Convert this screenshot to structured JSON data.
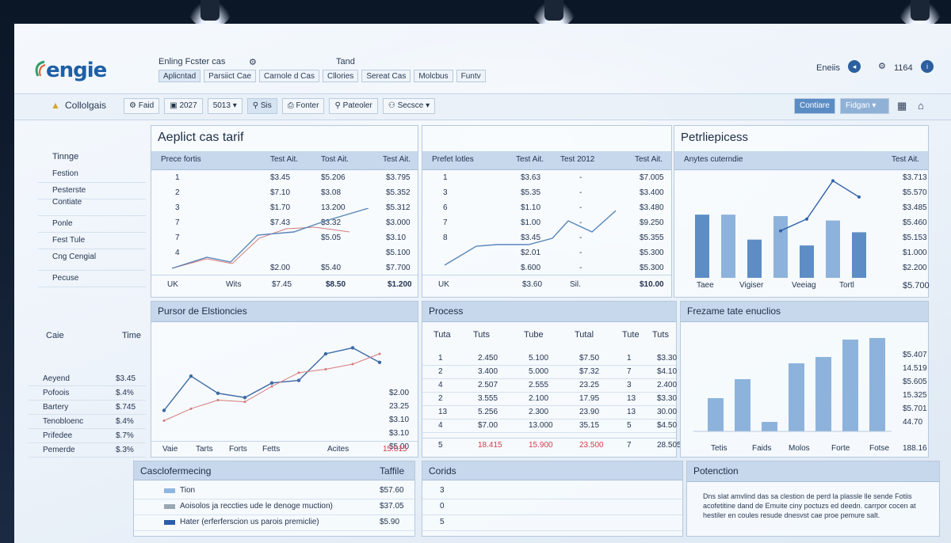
{
  "brand": {
    "logo": "engie"
  },
  "topnav": {
    "title": "Enling Fcster cas",
    "extra": "Tand",
    "tabs": [
      "Aplicntad",
      "Parsiict Cae",
      "Carnole d Cas",
      "Cllories",
      "Sereat Cas",
      "Molcbus",
      "Funtv"
    ]
  },
  "user": {
    "name": "Eneiis",
    "count": "1164"
  },
  "toolbar": {
    "section": "Collolgais",
    "items": [
      "Faid",
      "2027",
      "5013",
      "Sis",
      "Fonter",
      "Pateoler",
      "Secsce"
    ],
    "right_buttons": [
      "Contiare",
      "Fidgan"
    ]
  },
  "sidebar": {
    "heading": "Tinnge",
    "items": [
      "Festion",
      "Pesterste",
      "Contiate",
      "Ponle",
      "Fest Tule",
      "Cng Cengial",
      "Pecuse"
    ]
  },
  "tarif": {
    "title": "Aeplict cas tarif",
    "headers": [
      "Prece fortis",
      "Test Ait.",
      "Tost Ait.",
      "Test Ait."
    ],
    "rows": [
      [
        "1",
        "$3.45",
        "$5.206",
        "$3.795"
      ],
      [
        "2",
        "$7.10",
        "$3.08",
        "$5.352"
      ],
      [
        "3",
        "$1.70",
        "13.200",
        "$5.312"
      ],
      [
        "7",
        "$7.43",
        "$3.32",
        "$3.000"
      ],
      [
        "7",
        "",
        "$5.05",
        "$3.10"
      ],
      [
        "4",
        "",
        "",
        "$5.100"
      ],
      [
        "",
        "$2.00",
        "$5.40",
        "$7.700"
      ]
    ],
    "footer": [
      "UK",
      "Wits",
      "$7.45",
      "$8.50",
      "$1.200"
    ]
  },
  "prefer": {
    "headers": [
      "Prefet lotles",
      "Test Ait.",
      "Test 2012",
      "Test Ait."
    ],
    "rows": [
      [
        "1",
        "$3.63",
        "",
        "$7.005"
      ],
      [
        "3",
        "$5.35",
        "",
        "$3.400"
      ],
      [
        "6",
        "$1.10",
        "",
        "$3.480"
      ],
      [
        "7",
        "$1.00",
        "",
        "$9.250"
      ],
      [
        "8",
        "$3.45",
        "",
        "$5.355"
      ],
      [
        "",
        "$2.01",
        "",
        "$5.300"
      ],
      [
        "",
        "$.600",
        "",
        "$5.300"
      ]
    ],
    "footer": [
      "UK",
      "$3.60",
      "Sil.",
      "$10.00"
    ]
  },
  "petrl": {
    "title": "Petrliepicess",
    "header_left": "Anytes cuterndie",
    "header_right": "Test Ait.",
    "values": [
      "$3.713",
      "$5.570",
      "$3.485",
      "$5.460",
      "$5.153",
      "$1.000",
      "$2.200"
    ],
    "footer_value": "$5.700",
    "bar_labels": [
      "Taee",
      "Vigiser",
      "Veeiag",
      "Tortl"
    ]
  },
  "chart_petrl": {
    "type": "bar",
    "categories": [
      "Taee",
      "",
      "Vigiser",
      "",
      "Veeiag",
      "",
      "Tortl"
    ],
    "values": [
      86,
      86,
      52,
      84,
      44,
      78,
      62
    ],
    "line": [
      null,
      null,
      null,
      64,
      80,
      132,
      110
    ],
    "ylim": [
      0,
      140
    ]
  },
  "legacy": {
    "side_header": [
      "Caie",
      "Time"
    ],
    "side_items": [
      [
        "Aeyend",
        "$3.45"
      ],
      [
        "Pofoois",
        "$.4%"
      ],
      [
        "Bartery",
        "$.745"
      ],
      [
        "Tenobloenc",
        "$.4%"
      ],
      [
        "Prifedee",
        "$.7%"
      ],
      [
        "Pemerde",
        "$.3%"
      ]
    ],
    "title": "Pursor de Elstioncies",
    "values": [
      "$2.00",
      "23.25",
      "$3.10",
      "$3.10",
      "$5.00"
    ],
    "x_labels": [
      "Vaie",
      "Tarts",
      "Forts",
      "Fetts",
      "Acites"
    ],
    "highlight": "15.015"
  },
  "chart_legacy": {
    "type": "line",
    "series": [
      {
        "values": [
          30,
          70,
          50,
          45,
          62,
          65,
          96,
          103,
          86
        ]
      },
      {
        "values": [
          18,
          32,
          42,
          40,
          58,
          74,
          78,
          84,
          96
        ]
      }
    ],
    "ylim": [
      0,
      120
    ]
  },
  "process": {
    "title": "Process",
    "headers": [
      "Tuta",
      "Tuts",
      "Tube",
      "Tutal",
      "Tute",
      "Tuts"
    ],
    "rows": [
      [
        "1",
        "2.450",
        "5.100",
        "$7.50",
        "1",
        "$3.30"
      ],
      [
        "2",
        "3.400",
        "5.000",
        "$7.32",
        "7",
        "$4.10"
      ],
      [
        "4",
        "2.507",
        "2.555",
        "23.25",
        "3",
        "2.400"
      ],
      [
        "2",
        "3.555",
        "2.100",
        "17.95",
        "13",
        "$3.30"
      ],
      [
        "13",
        "5.256",
        "2.300",
        "23.90",
        "13",
        "30.00"
      ],
      [
        "4",
        "$7.00",
        "13.000",
        "35.15",
        "5",
        "$4.50"
      ]
    ],
    "footer": [
      "5",
      "18.415",
      "15.900",
      "23.500",
      "7",
      "28.505"
    ]
  },
  "frezame": {
    "title": "Frezame tate enuclios",
    "values": [
      "$5.407",
      "14.519",
      "$5.605",
      "15.325",
      "$5.701",
      "44.70"
    ],
    "footer_value": "188.16",
    "bar_labels": [
      "Tetis",
      "Faids",
      "Molos",
      "Forte",
      "Fotse"
    ]
  },
  "chart_frezame": {
    "type": "bar",
    "categories": [
      "Tetis",
      "Faids",
      "Molos",
      "Forte",
      "Fotse"
    ],
    "values": [
      42,
      66,
      12,
      86,
      94,
      116,
      118
    ],
    "ylim": [
      0,
      130
    ]
  },
  "casciofe": {
    "title": "Casclofermecing",
    "value_label": "Taffile",
    "rows": [
      {
        "label": "Tion",
        "value": "$57.60",
        "color": "#8fb6e0"
      },
      {
        "label": "Aoisolos ja reccties ude le denoge muction)",
        "value": "$37.05",
        "color": "#9aa8b4"
      },
      {
        "label": "Hater (erferferscion us parois premiclie)",
        "value": "$5.90",
        "color": "#2b5ea8"
      }
    ]
  },
  "corids": {
    "title": "Corids",
    "rows": [
      "3",
      "0",
      "5"
    ]
  },
  "potenction": {
    "title": "Potenction",
    "text": "Dns slat amvlind das sa clestion de perd la plassle lle sende Fotiis acofetitine dand de Emuite ciny poctuzs ed deedn. carrpor cocen at hestiler en coules resude dnesvst cae proe pemure salt."
  }
}
